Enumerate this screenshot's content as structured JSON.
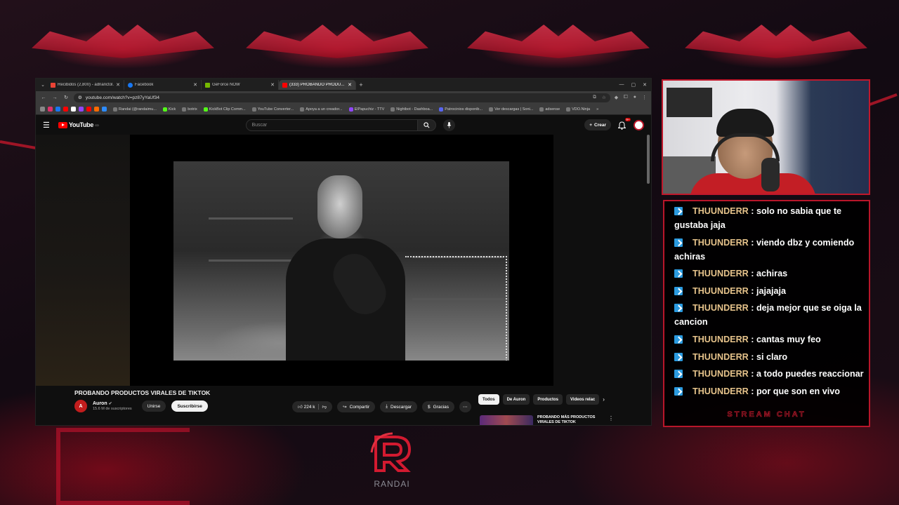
{
  "browser": {
    "tabs": [
      {
        "label": "Recibidos (2,800) - adrianctol...",
        "color": "#ea4335",
        "active": false
      },
      {
        "label": "Facebook",
        "color": "#1877f2",
        "active": false
      },
      {
        "label": "GeForce NOW",
        "color": "#76b900",
        "active": false
      },
      {
        "label": "(333) PROBANDO PRODU...",
        "color": "#ff0000",
        "active": true
      }
    ],
    "new_tab": "+",
    "url": "youtube.com/watch?v=pz87yYaUf34",
    "bookmarks": [
      "Randai (@randaimu...",
      "Kick",
      "botrix",
      "KickBot Clip Comm...",
      "YouTube Converter...",
      "Apoya a un creador...",
      "ElPapuchiz - TTV",
      "Nightbot - Dashboa...",
      "Patrocinios disponib...",
      "Ver descargas | Soni...",
      "adsense",
      "VDO.Ninja"
    ]
  },
  "youtube": {
    "logo_text": "YouTube",
    "logo_region": "CO",
    "search_placeholder": "Buscar",
    "create_label": "Crear",
    "notif_count": "9+",
    "video_title": "PROBANDO PRODUCTOS VIRALES DE TIKTOK",
    "channel_name": "Auron",
    "channel_initial": "A",
    "channel_subs": "15.6 M de suscriptores",
    "join_label": "Unirse",
    "subscribe_label": "Suscribirse",
    "likes": "224 k",
    "share_label": "Compartir",
    "download_label": "Descargar",
    "thanks_label": "Gracias",
    "chips": [
      "Todos",
      "De Auron",
      "Productos",
      "Videos relac"
    ],
    "rec_title": "PROBANDO MÁS PRODUCTOS VIRALES DE TIKTOK"
  },
  "chat": {
    "messages": [
      {
        "user": "THUUNDERR",
        "text": "solo no sabia que te gustaba jaja"
      },
      {
        "user": "THUUNDERR",
        "text": "viendo dbz y comiendo achiras"
      },
      {
        "user": "THUUNDERR",
        "text": "achiras"
      },
      {
        "user": "THUUNDERR",
        "text": "jajajaja"
      },
      {
        "user": "THUUNDERR",
        "text": "deja mejor que se oiga la cancion"
      },
      {
        "user": "THUUNDERR",
        "text": "cantas muy feo"
      },
      {
        "user": "THUUNDERR",
        "text": "si claro"
      },
      {
        "user": "THUUNDERR",
        "text": "a todo puedes reaccionar"
      },
      {
        "user": "THUUNDERR",
        "text": "por que son en vivo"
      }
    ],
    "footer": "STREAM CHAT"
  },
  "brand": {
    "name": "RANDAI",
    "accent": "#c0182b"
  }
}
